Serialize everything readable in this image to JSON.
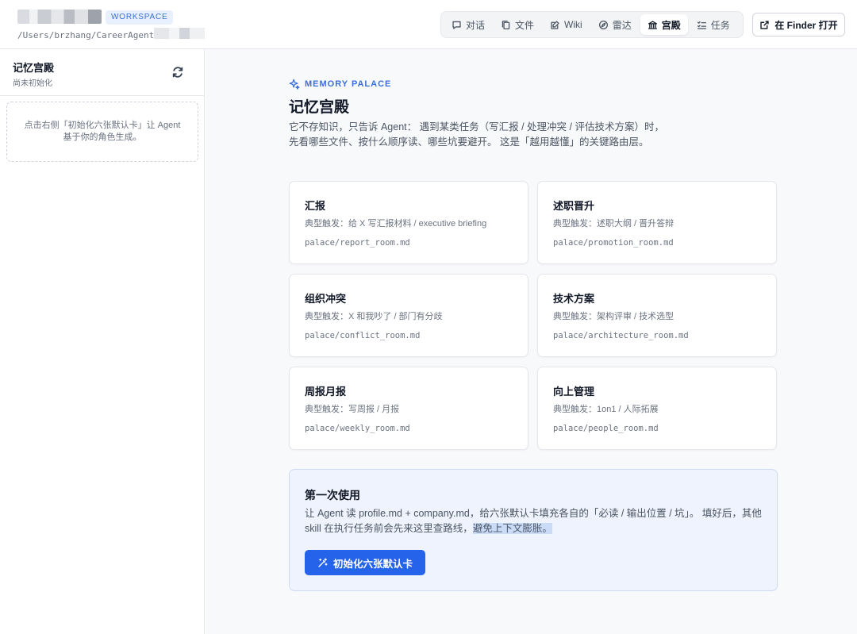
{
  "header": {
    "workspace_badge": "WORKSPACE",
    "workspace_path": "/Users/brzhang/CareerAgent/大",
    "nav": [
      {
        "label": "对话",
        "icon": "chat-icon",
        "active": false
      },
      {
        "label": "文件",
        "icon": "files-icon",
        "active": false
      },
      {
        "label": "Wiki",
        "icon": "wiki-icon",
        "active": false
      },
      {
        "label": "雷达",
        "icon": "radar-icon",
        "active": false
      },
      {
        "label": "宫殿",
        "icon": "palace-icon",
        "active": true
      },
      {
        "label": "任务",
        "icon": "tasks-icon",
        "active": false
      }
    ],
    "finder_label": "在 Finder 打开"
  },
  "sidebar": {
    "title": "记忆宫殿",
    "subtitle": "尚未初始化",
    "empty_hint": "点击右侧「初始化六张默认卡」让 Agent 基于你的角色生成。"
  },
  "main": {
    "eyebrow": "MEMORY PALACE",
    "title": "记忆宫殿",
    "description": "它不存知识，只告诉 Agent： 遇到某类任务（写汇报 / 处理冲突 / 评估技术方案）时， 先看哪些文件、按什么顺序读、哪些坑要避开。 这是「越用越懂」的关键路由层。",
    "cards": [
      {
        "title": "汇报",
        "trigger": "典型触发：给 X 写汇报材料 / executive briefing",
        "path": "palace/report_room.md"
      },
      {
        "title": "述职晋升",
        "trigger": "典型触发：述职大纲 / 晋升答辩",
        "path": "palace/promotion_room.md"
      },
      {
        "title": "组织冲突",
        "trigger": "典型触发：X 和我吵了 / 部门有分歧",
        "path": "palace/conflict_room.md"
      },
      {
        "title": "技术方案",
        "trigger": "典型触发：架构评审 / 技术选型",
        "path": "palace/architecture_room.md"
      },
      {
        "title": "周报月报",
        "trigger": "典型触发：写周报 / 月报",
        "path": "palace/weekly_room.md"
      },
      {
        "title": "向上管理",
        "trigger": "典型触发：1on1 / 人际拓展",
        "path": "palace/people_room.md"
      }
    ],
    "first_use": {
      "title": "第一次使用",
      "desc_main": "让 Agent 读 profile.md + company.md，给六张默认卡填充各自的「必读 / 输出位置 / 坑」。 填好后，其他 skill 在执行任务前会先来这里查路线，",
      "desc_highlight": "避免上下文膨胀。",
      "button_label": "初始化六张默认卡"
    }
  }
}
